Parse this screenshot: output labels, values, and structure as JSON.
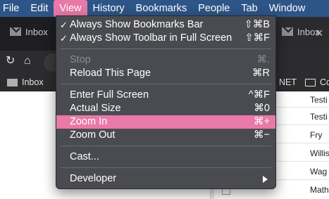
{
  "menubar": {
    "items": [
      "File",
      "Edit",
      "View",
      "History",
      "Bookmarks",
      "People",
      "Tab",
      "Window"
    ],
    "active": "View"
  },
  "tabs": [
    {
      "title": "Inbox"
    },
    {
      "title": "Inbox"
    }
  ],
  "bookmarks": [
    {
      "label": "Inbox"
    },
    {
      "label": "NET"
    },
    {
      "label": "Co"
    }
  ],
  "table_cells": [
    "Testi",
    "Testi",
    "Fry",
    "Willis",
    "Wag",
    "Math"
  ],
  "view_menu": {
    "items": [
      {
        "label": "Always Show Bookmarks Bar",
        "shortcut": "⇧⌘B",
        "checked": "✓"
      },
      {
        "label": "Always Show Toolbar in Full Screen",
        "shortcut": "⇧⌘F",
        "checked": "✓"
      },
      {
        "label": "Stop",
        "shortcut": "⌘.",
        "disabled": true
      },
      {
        "label": "Reload This Page",
        "shortcut": "⌘R"
      },
      {
        "label": "Enter Full Screen",
        "shortcut": "^⌘F"
      },
      {
        "label": "Actual Size",
        "shortcut": "⌘0"
      },
      {
        "label": "Zoom In",
        "shortcut": "⌘+",
        "highlighted": true
      },
      {
        "label": "Zoom Out",
        "shortcut": "⌘−"
      },
      {
        "label": "Cast..."
      },
      {
        "label": "Developer",
        "submenu": true
      }
    ]
  },
  "colors": {
    "menubar": "#2e5587",
    "highlight": "#e879a8",
    "menu_bg": "#4a4b50"
  }
}
